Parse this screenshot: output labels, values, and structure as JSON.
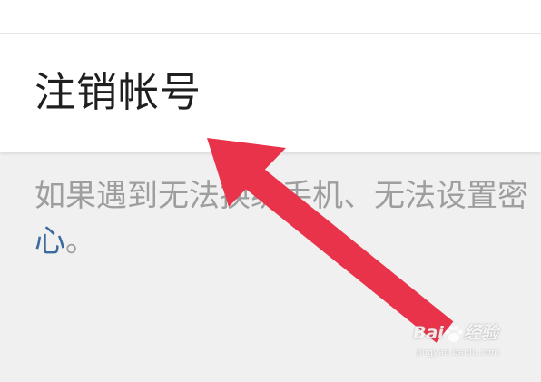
{
  "settings": {
    "cancel_account_label": "注销帐号"
  },
  "hint": {
    "line1": "如果遇到无法换绑手机、无法设置密",
    "link_part": "心",
    "line2_suffix": "。"
  },
  "watermark": {
    "brand_left": "Bai",
    "brand_right": "经验",
    "url": "jingyan.baidu.com"
  },
  "icons": {
    "annotation": "red-arrow-icon",
    "watermark": "baidu-paw-icon"
  },
  "colors": {
    "arrow": "#e8334a",
    "link": "#3b6a9e",
    "hint_text": "#9e9e9e",
    "page_background": "#f0f0f0"
  }
}
